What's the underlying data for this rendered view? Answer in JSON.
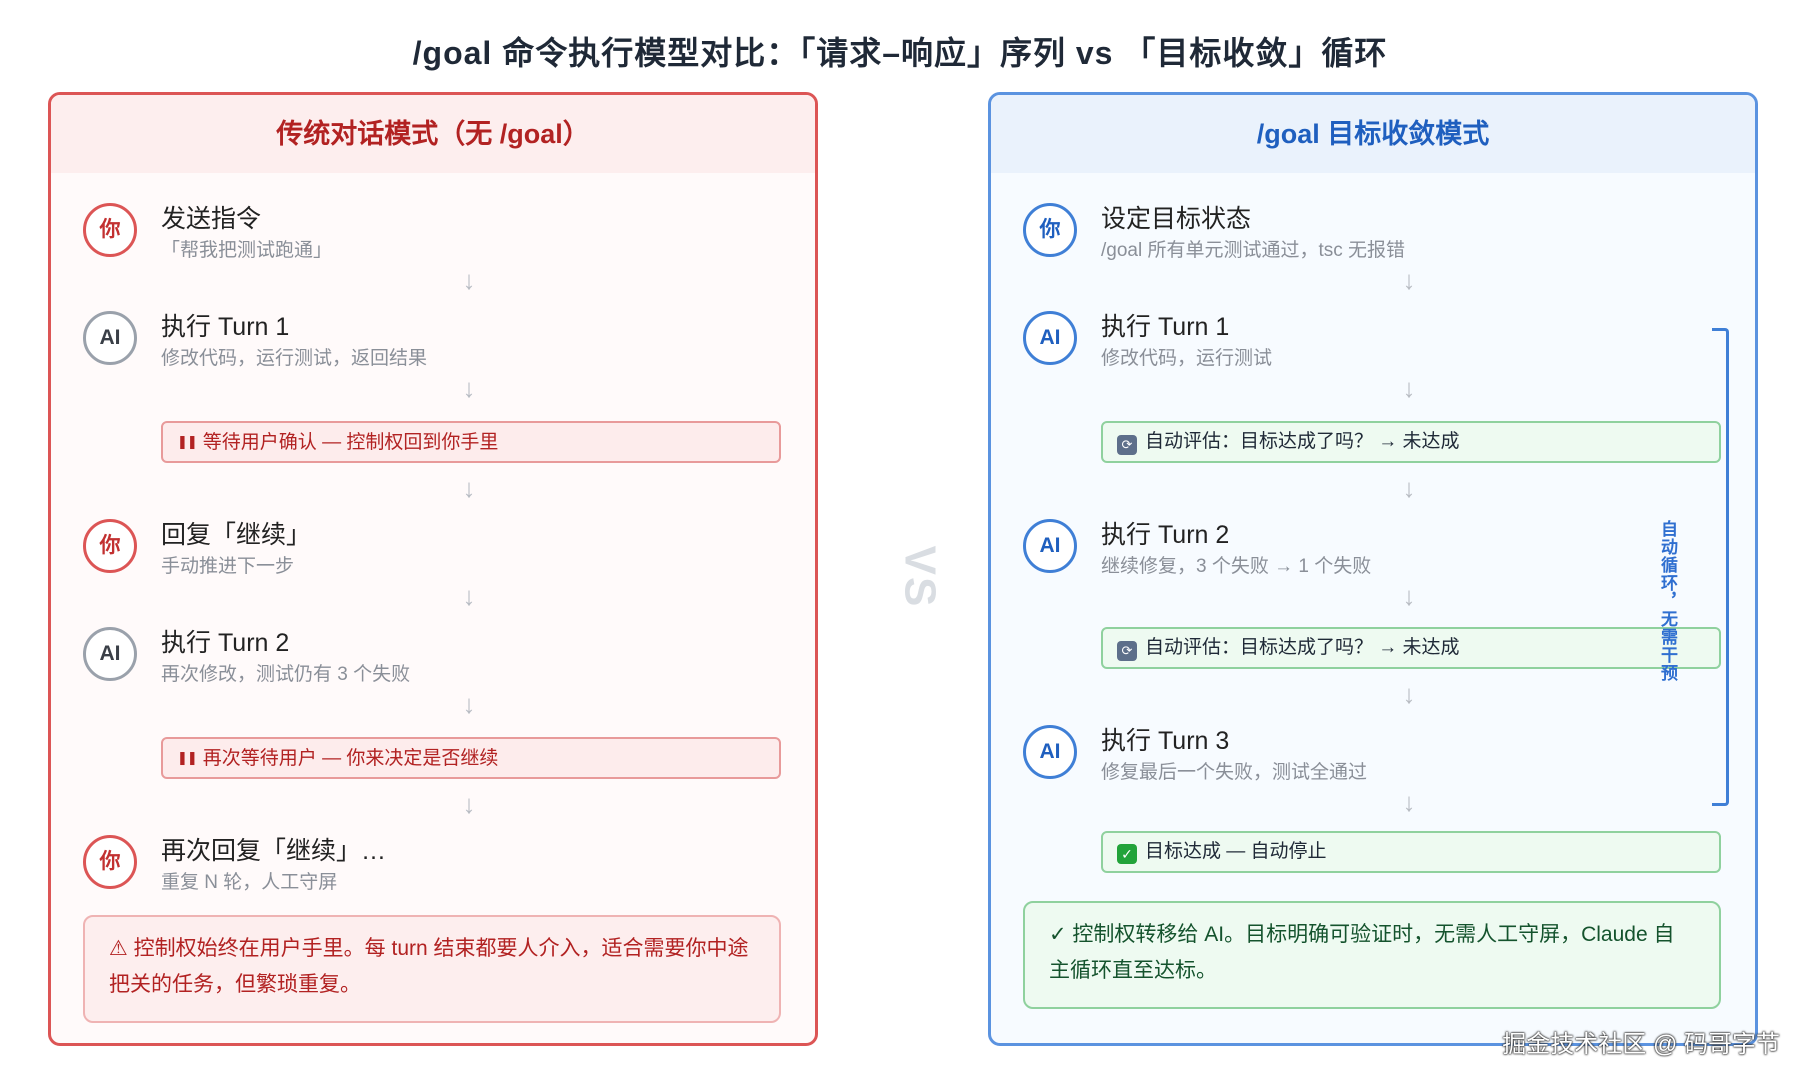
{
  "title": "/goal 命令执行模型对比：「请求–响应」序列 vs 「目标收敛」循环",
  "vs_label": "VS",
  "left": {
    "header": "传统对话模式（无 /goal）",
    "steps": [
      {
        "avatar": "你",
        "title": "发送指令",
        "sub": "「帮我把测试跑通」"
      },
      {
        "avatar": "AI",
        "title": "执行 Turn 1",
        "sub": "修改代码，运行测试，返回结果"
      },
      {
        "avatar": "你",
        "title": "回复「继续」",
        "sub": "手动推进下一步"
      },
      {
        "avatar": "AI",
        "title": "执行 Turn 2",
        "sub": "再次修改，测试仍有 3 个失败"
      },
      {
        "avatar": "你",
        "title": "再次回复「继续」…",
        "sub": "重复 N 轮，人工守屏"
      }
    ],
    "waits": [
      "等待用户确认 — 控制权回到你手里",
      "再次等待用户 — 你来决定是否继续"
    ],
    "wait_icon": "pause-icon",
    "note": "⚠ 控制权始终在用户手里。每 turn 结束都要人介入，适合需要你中途把关的任务，但繁琐重复。"
  },
  "right": {
    "header": "/goal 目标收敛模式",
    "steps": [
      {
        "avatar": "你",
        "title": "设定目标状态",
        "sub": "/goal 所有单元测试通过，tsc 无报错"
      },
      {
        "avatar": "AI",
        "title": "执行 Turn 1",
        "sub": "修改代码，运行测试"
      },
      {
        "avatar": "AI",
        "title": "执行 Turn 2",
        "sub": "继续修复，3 个失败 → 1 个失败"
      },
      {
        "avatar": "AI",
        "title": "执行 Turn 3",
        "sub": "修复最后一个失败，测试全通过"
      }
    ],
    "evals": [
      "自动评估：目标达成了吗？ → 未达成",
      "自动评估：目标达成了吗？ → 未达成",
      "目标达成 — 自动停止"
    ],
    "eval_icon": "refresh-icon",
    "done_icon": "check-box-icon",
    "loop_label": "自动循环，无需干预",
    "note": "✓ 控制权转移给 AI。目标明确可验证时，无需人工守屏，Claude 自主循环直至达标。"
  },
  "watermark": "掘金技术社区 @ 码哥字节",
  "colors": {
    "red": "#dc5555",
    "blue": "#3f7fd6",
    "green": "#22a33a"
  }
}
